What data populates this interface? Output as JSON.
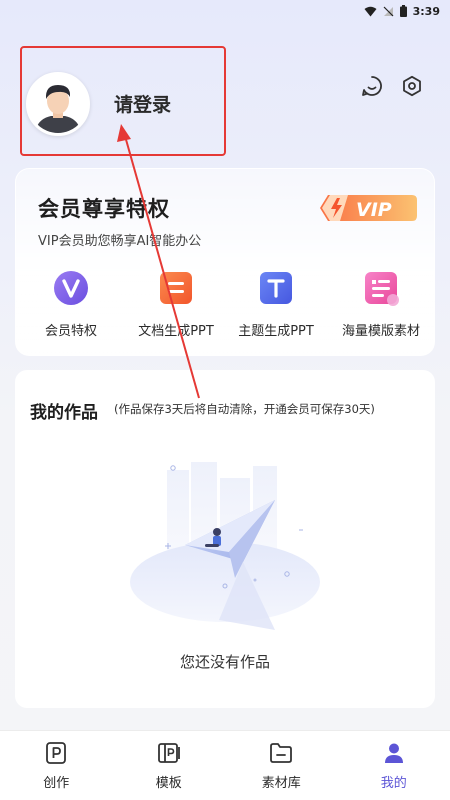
{
  "status_bar": {
    "time": "3:39"
  },
  "header": {
    "login_label": "请登录"
  },
  "vip": {
    "title": "会员尊享特权",
    "subtitle": "VIP会员助您畅享AI智能办公",
    "badge": "VIP",
    "features": [
      {
        "label": "会员特权",
        "icon": "vip-v-icon"
      },
      {
        "label": "文档生成PPT",
        "icon": "document-icon"
      },
      {
        "label": "主题生成PPT",
        "icon": "text-t-icon"
      },
      {
        "label": "海量模版素材",
        "icon": "template-icon"
      }
    ]
  },
  "works": {
    "title": "我的作品",
    "note": "(作品保存3天后将自动清除，开通会员可保存30天)",
    "empty_text": "您还没有作品"
  },
  "nav": {
    "items": [
      {
        "label": "创作",
        "icon": "create-p-icon",
        "active": false
      },
      {
        "label": "模板",
        "icon": "template-icon",
        "active": false
      },
      {
        "label": "素材库",
        "icon": "folder-icon",
        "active": false
      },
      {
        "label": "我的",
        "icon": "user-icon",
        "active": true
      }
    ]
  },
  "colors": {
    "accent": "#5c55d6",
    "highlight_box": "#e53935",
    "vip_orange": "#f57c32"
  }
}
